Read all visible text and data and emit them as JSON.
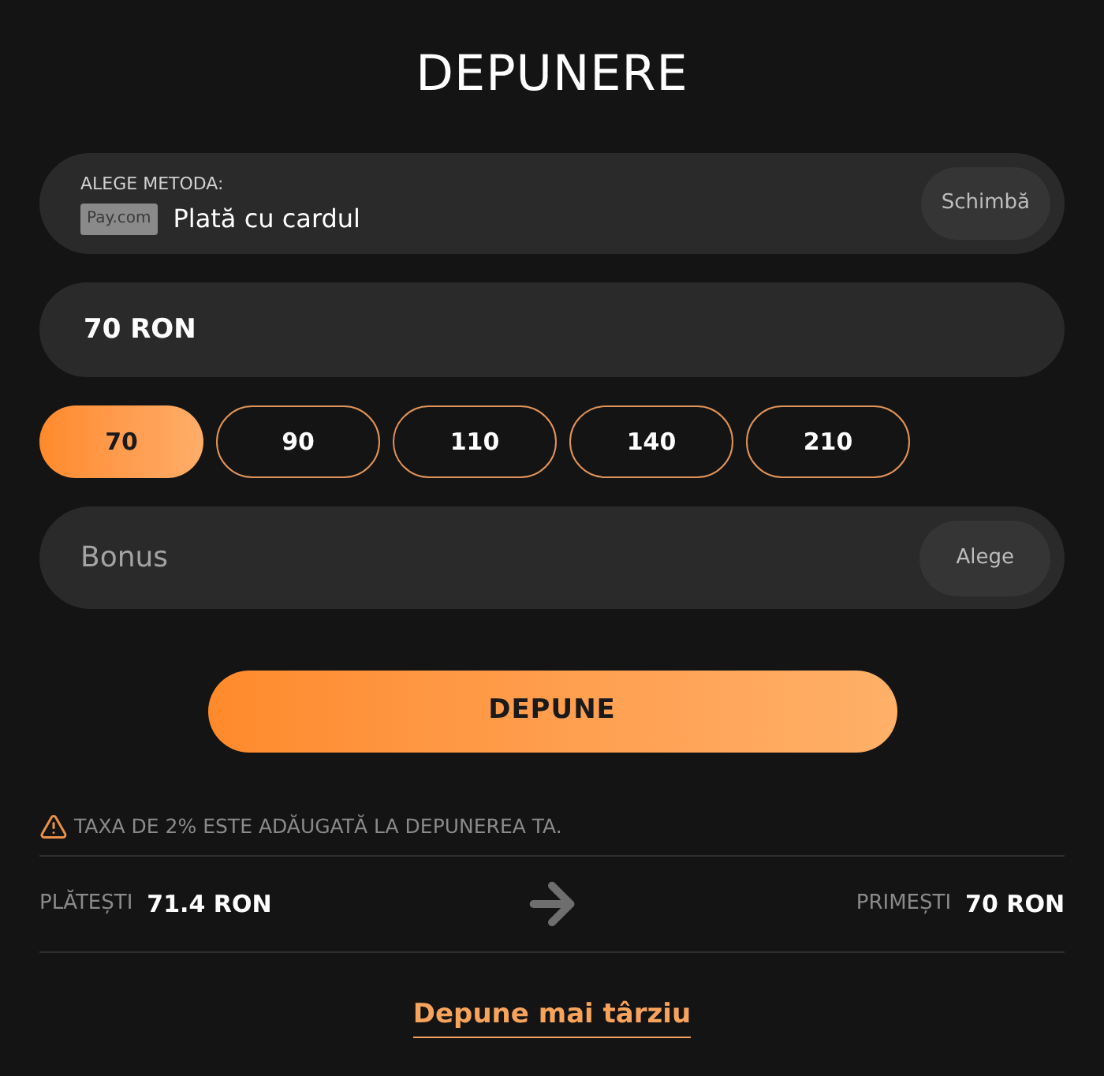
{
  "title": "DEPUNERE",
  "method": {
    "label": "ALEGE METODA:",
    "logo": "Pay.com",
    "name": "Plată cu cardul",
    "button": "Schimbă"
  },
  "amount": {
    "value": "70 RON"
  },
  "presets": [
    {
      "label": "70",
      "selected": true
    },
    {
      "label": "90",
      "selected": false
    },
    {
      "label": "110",
      "selected": false
    },
    {
      "label": "140",
      "selected": false
    },
    {
      "label": "210",
      "selected": false
    }
  ],
  "bonus": {
    "placeholder": "Bonus",
    "button": "Alege"
  },
  "submit": "DEPUNE",
  "notice": "TAXA DE 2% ESTE ADĂUGATĂ LA DEPUNEREA TA.",
  "summary": {
    "pay": {
      "label": "PLĂTEȘTI",
      "amount": "71.4 RON"
    },
    "receive": {
      "label": "PRIMEȘTI",
      "amount": "70 RON"
    }
  },
  "later_link": "Depune mai târziu"
}
